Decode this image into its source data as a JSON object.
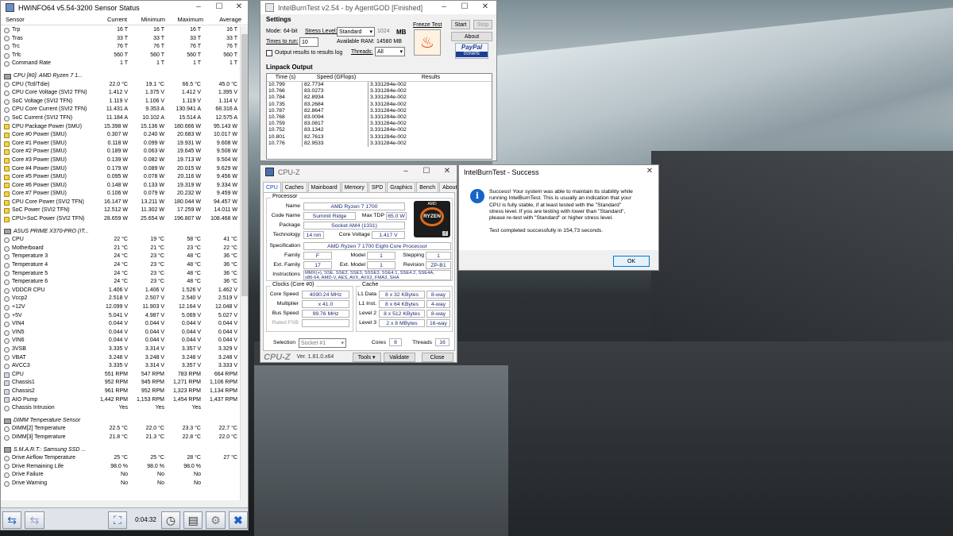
{
  "hwinfo": {
    "title": "HWiNFO64 v5.54-3200 Sensor Status",
    "headers": [
      "Sensor",
      "Current",
      "Minimum",
      "Maximum",
      "Average"
    ],
    "elapsed": "0:04:32",
    "rows": [
      {
        "t": "s",
        "i": "c",
        "n": "Trp",
        "v": [
          "16 T",
          "16 T",
          "16 T",
          "16 T"
        ]
      },
      {
        "t": "s",
        "i": "c",
        "n": "Tras",
        "v": [
          "33 T",
          "33 T",
          "33 T",
          "33 T"
        ]
      },
      {
        "t": "s",
        "i": "c",
        "n": "Trc",
        "v": [
          "76 T",
          "76 T",
          "76 T",
          "76 T"
        ]
      },
      {
        "t": "s",
        "i": "c",
        "n": "Trfc",
        "v": [
          "560 T",
          "560 T",
          "560 T",
          "560 T"
        ]
      },
      {
        "t": "s",
        "i": "c",
        "n": "Command Rate",
        "v": [
          "1 T",
          "1 T",
          "1 T",
          "1 T"
        ]
      },
      {
        "t": "sp"
      },
      {
        "t": "g",
        "n": "CPU [#0]: AMD Ryzen 7 1..."
      },
      {
        "t": "s",
        "i": "c",
        "n": "CPU (Tctl/Tdie)",
        "v": [
          "22.0 °C",
          "19.1 °C",
          "66.5 °C",
          "45.0 °C"
        ]
      },
      {
        "t": "s",
        "i": "c",
        "n": "CPU Core Voltage (SVI2 TFN)",
        "v": [
          "1.412 V",
          "1.375 V",
          "1.412 V",
          "1.395 V"
        ]
      },
      {
        "t": "s",
        "i": "c",
        "n": "SoC Voltage (SVI2 TFN)",
        "v": [
          "1.119 V",
          "1.106 V",
          "1.119 V",
          "1.114 V"
        ]
      },
      {
        "t": "s",
        "i": "c",
        "n": "CPU Core Current (SVI2 TFN)",
        "v": [
          "11.431 A",
          "9.353 A",
          "130.941 A",
          "68.316 A"
        ]
      },
      {
        "t": "s",
        "i": "c",
        "n": "SoC Current (SVI2 TFN)",
        "v": [
          "11.184 A",
          "10.102 A",
          "15.514 A",
          "12.575 A"
        ]
      },
      {
        "t": "s",
        "i": "y",
        "n": "CPU Package Power (SMU)",
        "v": [
          "15.398 W",
          "15.136 W",
          "180.666 W",
          "95.143 W"
        ]
      },
      {
        "t": "s",
        "i": "y",
        "n": "Core #0 Power (SMU)",
        "v": [
          "0.307 W",
          "0.240 W",
          "20.683 W",
          "10.017 W"
        ]
      },
      {
        "t": "s",
        "i": "y",
        "n": "Core #1 Power (SMU)",
        "v": [
          "0.118 W",
          "0.099 W",
          "19.931 W",
          "9.608 W"
        ]
      },
      {
        "t": "s",
        "i": "y",
        "n": "Core #2 Power (SMU)",
        "v": [
          "0.189 W",
          "0.063 W",
          "19.645 W",
          "9.508 W"
        ]
      },
      {
        "t": "s",
        "i": "y",
        "n": "Core #3 Power (SMU)",
        "v": [
          "0.139 W",
          "0.082 W",
          "19.713 W",
          "9.504 W"
        ]
      },
      {
        "t": "s",
        "i": "y",
        "n": "Core #4 Power (SMU)",
        "v": [
          "0.179 W",
          "0.089 W",
          "20.015 W",
          "9.629 W"
        ]
      },
      {
        "t": "s",
        "i": "y",
        "n": "Core #5 Power (SMU)",
        "v": [
          "0.095 W",
          "0.078 W",
          "20.116 W",
          "9.456 W"
        ]
      },
      {
        "t": "s",
        "i": "y",
        "n": "Core #6 Power (SMU)",
        "v": [
          "0.148 W",
          "0.133 W",
          "19.319 W",
          "9.334 W"
        ]
      },
      {
        "t": "s",
        "i": "y",
        "n": "Core #7 Power (SMU)",
        "v": [
          "0.106 W",
          "0.079 W",
          "20.232 W",
          "9.459 W"
        ]
      },
      {
        "t": "s",
        "i": "y",
        "n": "CPU Core Power (SVI2 TFN)",
        "v": [
          "16.147 W",
          "13.211 W",
          "180.044 W",
          "94.457 W"
        ]
      },
      {
        "t": "s",
        "i": "y",
        "n": "SoC Power (SVI2 TFN)",
        "v": [
          "12.512 W",
          "11.302 W",
          "17.259 W",
          "14.011 W"
        ]
      },
      {
        "t": "s",
        "i": "y",
        "n": "CPU+SoC Power (SVI2 TFN)",
        "v": [
          "28.659 W",
          "25.654 W",
          "196.807 W",
          "108.468 W"
        ]
      },
      {
        "t": "sp"
      },
      {
        "t": "g",
        "n": "ASUS PRIME X370-PRO (IT..."
      },
      {
        "t": "s",
        "i": "c",
        "n": "CPU",
        "v": [
          "22 °C",
          "19 °C",
          "58 °C",
          "41 °C"
        ]
      },
      {
        "t": "s",
        "i": "c",
        "n": "Motherboard",
        "v": [
          "21 °C",
          "21 °C",
          "23 °C",
          "22 °C"
        ]
      },
      {
        "t": "s",
        "i": "c",
        "n": "Temperature 3",
        "v": [
          "24 °C",
          "23 °C",
          "48 °C",
          "36 °C"
        ]
      },
      {
        "t": "s",
        "i": "c",
        "n": "Temperature 4",
        "v": [
          "24 °C",
          "23 °C",
          "48 °C",
          "36 °C"
        ]
      },
      {
        "t": "s",
        "i": "c",
        "n": "Temperature 5",
        "v": [
          "24 °C",
          "23 °C",
          "48 °C",
          "36 °C"
        ]
      },
      {
        "t": "s",
        "i": "c",
        "n": "Temperature 6",
        "v": [
          "24 °C",
          "23 °C",
          "48 °C",
          "36 °C"
        ]
      },
      {
        "t": "s",
        "i": "c",
        "n": "VDDCR CPU",
        "v": [
          "1.406 V",
          "1.406 V",
          "1.526 V",
          "1.462 V"
        ]
      },
      {
        "t": "s",
        "i": "c",
        "n": "Vccp2",
        "v": [
          "2.518 V",
          "2.507 V",
          "2.540 V",
          "2.519 V"
        ]
      },
      {
        "t": "s",
        "i": "c",
        "n": "+12V",
        "v": [
          "12.099 V",
          "11.903 V",
          "12.164 V",
          "12.048 V"
        ]
      },
      {
        "t": "s",
        "i": "c",
        "n": "+5V",
        "v": [
          "5.041 V",
          "4.987 V",
          "5.069 V",
          "5.027 V"
        ]
      },
      {
        "t": "s",
        "i": "c",
        "n": "VIN4",
        "v": [
          "0.044 V",
          "0.044 V",
          "0.044 V",
          "0.044 V"
        ]
      },
      {
        "t": "s",
        "i": "c",
        "n": "VIN5",
        "v": [
          "0.044 V",
          "0.044 V",
          "0.044 V",
          "0.044 V"
        ]
      },
      {
        "t": "s",
        "i": "c",
        "n": "VIN6",
        "v": [
          "0.044 V",
          "0.044 V",
          "0.044 V",
          "0.044 V"
        ]
      },
      {
        "t": "s",
        "i": "c",
        "n": "3VSB",
        "v": [
          "3.335 V",
          "3.314 V",
          "3.357 V",
          "3.329 V"
        ]
      },
      {
        "t": "s",
        "i": "c",
        "n": "VBAT",
        "v": [
          "3.248 V",
          "3.248 V",
          "3.248 V",
          "3.248 V"
        ]
      },
      {
        "t": "s",
        "i": "c",
        "n": "AVCC3",
        "v": [
          "3.335 V",
          "3.314 V",
          "3.357 V",
          "3.333 V"
        ]
      },
      {
        "t": "s",
        "i": "b",
        "n": "CPU",
        "v": [
          "551 RPM",
          "547 RPM",
          "783 RPM",
          "664 RPM"
        ]
      },
      {
        "t": "s",
        "i": "b",
        "n": "Chassis1",
        "v": [
          "952 RPM",
          "945 RPM",
          "1,271 RPM",
          "1,106 RPM"
        ]
      },
      {
        "t": "s",
        "i": "b",
        "n": "Chassis2",
        "v": [
          "961 RPM",
          "952 RPM",
          "1,323 RPM",
          "1,134 RPM"
        ]
      },
      {
        "t": "s",
        "i": "b",
        "n": "AIO Pump",
        "v": [
          "1,442 RPM",
          "1,153 RPM",
          "1,454 RPM",
          "1,437 RPM"
        ]
      },
      {
        "t": "s",
        "i": "c",
        "n": "Chassis Intrusion",
        "v": [
          "Yes",
          "Yes",
          "Yes",
          ""
        ]
      },
      {
        "t": "sp"
      },
      {
        "t": "g",
        "n": "DIMM Temperature Sensor"
      },
      {
        "t": "s",
        "i": "c",
        "n": "DIMM[2] Temperature",
        "v": [
          "22.5 °C",
          "22.0 °C",
          "23.3 °C",
          "22.7 °C"
        ]
      },
      {
        "t": "s",
        "i": "c",
        "n": "DIMM[3] Temperature",
        "v": [
          "21.8 °C",
          "21.3 °C",
          "22.8 °C",
          "22.0 °C"
        ]
      },
      {
        "t": "sp"
      },
      {
        "t": "g",
        "n": "S.M.A.R.T.: Samsung SSD ..."
      },
      {
        "t": "s",
        "i": "c",
        "n": "Drive Airflow Temperature",
        "v": [
          "25 °C",
          "25 °C",
          "28 °C",
          "27 °C"
        ]
      },
      {
        "t": "s",
        "i": "c",
        "n": "Drive Remaining Life",
        "v": [
          "98.0 %",
          "98.0 %",
          "98.0 %",
          ""
        ]
      },
      {
        "t": "s",
        "i": "c",
        "n": "Drive Failure",
        "v": [
          "No",
          "No",
          "No",
          ""
        ]
      },
      {
        "t": "s",
        "i": "c",
        "n": "Drive Warning",
        "v": [
          "No",
          "No",
          "No",
          ""
        ]
      }
    ]
  },
  "ibt": {
    "title": "IntelBurnTest v2.54 - by AgentGOD [Finished]",
    "settings": "Settings",
    "mode_label": "Mode:",
    "mode": "64-bit",
    "stress_label": "Stress Level:",
    "stress": "Standard",
    "mb_val": "1024",
    "mb": "MB",
    "times_label": "Times to run:",
    "times": "10",
    "ram_label": "Available RAM:",
    "ram": "14580 MB",
    "threads_label": "Threads:",
    "threads": "All",
    "output_label": "Output results to results log",
    "freeze": "Freeze Test",
    "start": "Start",
    "stop": "Stop",
    "about": "About",
    "paypal": "PayPal",
    "donate": "DONATE",
    "linpack": "Linpack Output",
    "cols": [
      "Time (s)",
      "Speed (GFlops)",
      "Results"
    ],
    "rows": [
      [
        "10.799",
        "82.7734",
        "3.331284e-002"
      ],
      [
        "10.766",
        "83.0273",
        "3.331284e-002"
      ],
      [
        "10.784",
        "82.8934",
        "3.331284e-002"
      ],
      [
        "10.735",
        "83.2684",
        "3.331284e-002"
      ],
      [
        "10.787",
        "82.8647",
        "3.331284e-002"
      ],
      [
        "10.768",
        "83.0094",
        "3.331284e-002"
      ],
      [
        "10.759",
        "83.0817",
        "3.331284e-002"
      ],
      [
        "10.752",
        "83.1342",
        "3.331284e-002"
      ],
      [
        "10.801",
        "82.7613",
        "3.331284e-002"
      ],
      [
        "10.776",
        "82.9533",
        "3.331284e-002"
      ]
    ]
  },
  "cpuz": {
    "title": "CPU-Z",
    "tabs": [
      "CPU",
      "Caches",
      "Mainboard",
      "Memory",
      "SPD",
      "Graphics",
      "Bench",
      "About"
    ],
    "processor": "Processor",
    "name_k": "Name",
    "name": "AMD Ryzen 7 1700",
    "code_k": "Code Name",
    "code": "Summit Ridge",
    "tdp_k": "Max TDP",
    "tdp": "65.0 W",
    "pkg_k": "Package",
    "pkg": "Socket AM4 (1331)",
    "tech_k": "Technology",
    "tech": "14 nm",
    "cv_k": "Core Voltage",
    "cv": "1.417 V",
    "spec_k": "Specification",
    "spec": "AMD Ryzen 7 1700 Eight-Core Processor",
    "fam_k": "Family",
    "fam": "F",
    "model_k": "Model",
    "model": "1",
    "step_k": "Stepping",
    "step": "1",
    "efam_k": "Ext. Family",
    "efam": "17",
    "emodel_k": "Ext. Model",
    "emodel": "1",
    "rev_k": "Revision",
    "rev": "ZP-B1",
    "inst_k": "Instructions",
    "inst1": "MMX(+), SSE, SSE2, SSE3, SSSE3, SSE4.1, SSE4.2, SSE4A,",
    "inst2": "x86-64, AMD-V, AES, AVX, AVX2, FMA3, SHA",
    "clocks": "Clocks (Core #0)",
    "cs_k": "Core Speed",
    "cs": "4090.24 MHz",
    "mul_k": "Multiplier",
    "mul": "x 41.0",
    "bus_k": "Bus Speed",
    "bus": "99.76 MHz",
    "fsb_k": "Rated FSB",
    "cache": "Cache",
    "l1d_k": "L1 Data",
    "l1d": "8 x 32 KBytes",
    "l1d_w": "8-way",
    "l1i_k": "L1 Inst.",
    "l1i": "8 x 64 KBytes",
    "l1i_w": "4-way",
    "l2_k": "Level 2",
    "l2": "8 x 512 KBytes",
    "l2_w": "8-way",
    "l3_k": "Level 3",
    "l3": "2 x 8 MBytes",
    "l3_w": "16-way",
    "sel_k": "Selection",
    "sel": "Socket #1",
    "cores_k": "Cores",
    "cores": "8",
    "threads_k": "Threads",
    "threads": "16",
    "logo": "CPU-Z",
    "version": "Ver. 1.81.0.x64",
    "tools": "Tools",
    "validate": "Validate",
    "close": "Close",
    "badge_brand": "RYZEN",
    "badge_num": "7",
    "amd": "AMD"
  },
  "popup": {
    "title": "IntelBurnTest - Success",
    "lines": [
      "Success! Your system was able to maintain its stability while",
      "running IntelBurnTest. This is usually an indication that your",
      "CPU is fully stable, if at least tested with the \"Standard\"",
      "stress level. If you are testing with lower than \"Standard\",",
      "please re-test with \"Standard\" or higher stress level.",
      "",
      "Test completed successfully in 154,73 seconds."
    ],
    "ok": "OK"
  },
  "colors": {
    "hw_accent": "#2b62b8",
    "cpuz_val": "#1a2a7a",
    "info_blue": "#1565c8"
  }
}
